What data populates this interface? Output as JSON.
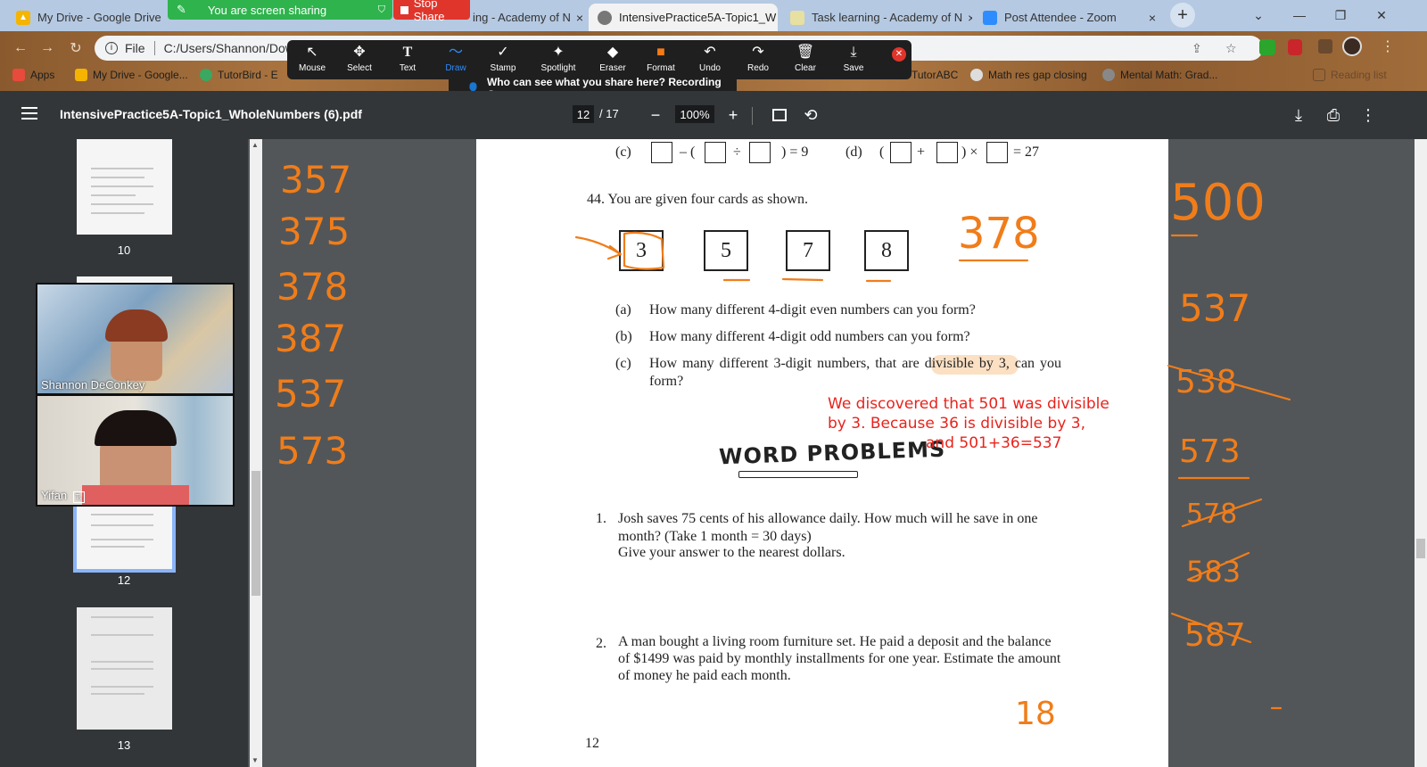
{
  "browser": {
    "tabs": [
      {
        "title": "My Drive - Google Drive",
        "active": false
      },
      {
        "title": "ing - Academy of N",
        "active": false
      },
      {
        "title": "IntensivePractice5A-Topic1_W",
        "active": true
      },
      {
        "title": "Task learning - Academy of N",
        "active": false
      },
      {
        "title": "Post Attendee - Zoom",
        "active": false
      }
    ],
    "new_tab": "+",
    "close_glyph": "×",
    "window_buttons": {
      "dropdown": "⌄",
      "minimize": "—",
      "restore": "❐",
      "close": "✕"
    },
    "address": {
      "scheme": "File",
      "path": "C:/Users/Shannon/Dow"
    },
    "bookmarks": [
      "Apps",
      "My Drive - Google...",
      "TutorBird - E",
      "TutorABC",
      "Math res gap closing",
      "Mental Math: Grad...",
      "Reading list"
    ]
  },
  "zoom": {
    "sharing_label": "You are screen sharing",
    "stop_share_label": "Stop Share",
    "tools": [
      "Mouse",
      "Select",
      "Text",
      "Draw",
      "Stamp",
      "Spotlight",
      "Eraser",
      "Format",
      "Undo",
      "Redo",
      "Clear",
      "Save"
    ],
    "tool_glyphs": [
      "↖",
      "✥",
      "T",
      "〜",
      "✓",
      "✦",
      "◆",
      "■",
      "↶",
      "↷",
      "🗑",
      "⤓"
    ],
    "selected_tool": "Draw",
    "recording_message": "Who can see what you share here? Recording On",
    "participants": [
      "Shannon DeConkey",
      "Yifan"
    ]
  },
  "pdf": {
    "filename": "IntensivePractice5A-Topic1_WholeNumbers (6).pdf",
    "current_page": "12",
    "page_total": "/ 17",
    "zoom": "100%",
    "thumbnail_labels": [
      "10",
      "12",
      "13"
    ]
  },
  "page": {
    "q43_c_label": "(c)",
    "q43_c_ops": [
      "– (",
      "÷",
      ") = 9"
    ],
    "q43_d_label": "(d)",
    "q43_d_ops": [
      "(",
      "+",
      ") ×",
      "= 27"
    ],
    "q44_text": "44.  You are given four cards as shown.",
    "cards": [
      "3",
      "5",
      "7",
      "8"
    ],
    "sub_questions": [
      {
        "label": "(a)",
        "text": "How many different 4-digit even numbers can you form?"
      },
      {
        "label": "(b)",
        "text": "How many different 4-digit odd numbers can you form?"
      },
      {
        "label": "(c)",
        "text": "How many different 3-digit numbers, that are divisible by 3, can you",
        "text2": "form?"
      }
    ],
    "word_problems_title": "WORD PROBLEMS",
    "problems": [
      {
        "num": "1.",
        "lines": [
          "Josh saves 75 cents of his allowance daily. How much will he save in one",
          "month? (Take 1 month = 30 days)",
          "Give your answer to the nearest dollars."
        ]
      },
      {
        "num": "2.",
        "lines": [
          "A man bought a living room furniture set. He paid a deposit and the balance",
          "of $1499 was paid by monthly installments for one year. Estimate the amount",
          "of money he paid each month."
        ]
      }
    ],
    "page_number": "12"
  },
  "annotation_note": [
    "We discovered that 501 was divisible",
    "by 3.  Because 36 is divisible by 3,",
    "and 501+36=537"
  ],
  "handwriting": {
    "left_column": [
      "357",
      "375",
      "378",
      "387",
      "537",
      "573"
    ],
    "right_column": [
      "500",
      "537",
      "538",
      "573",
      "578",
      "583",
      "587"
    ],
    "near_cards": "378",
    "bottom": "18",
    "ink_color": "#f07d1a"
  }
}
